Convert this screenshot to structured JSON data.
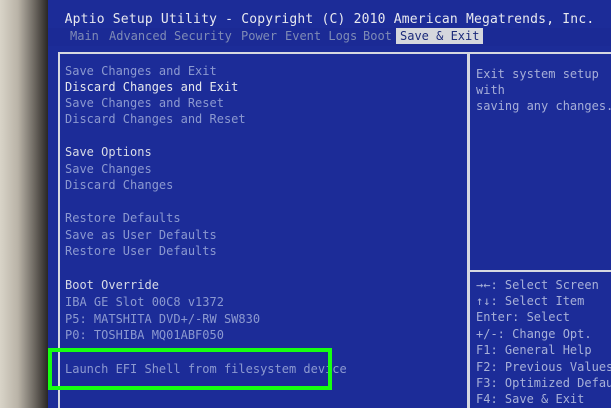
{
  "bios": {
    "title": "Aptio Setup Utility - Copyright (C) 2010 American Megatrends, Inc.",
    "menu": [
      "Main",
      "Advanced",
      "Security",
      "Power",
      "Event Logs",
      "Boot",
      "Save & Exit"
    ],
    "items": [
      "Save Changes and Exit",
      "Discard Changes and Exit",
      "Save Changes and Reset",
      "Discard Changes and Reset",
      "Save Options",
      "Save Changes",
      "Discard Changes",
      "Restore Defaults",
      "Save as User Defaults",
      "Restore User Defaults",
      "Boot Override",
      "IBA GE Slot 00C8 v1372",
      "P5: MATSHITA DVD+/-RW SW830",
      "P0: TOSHIBA MQ01ABF050",
      "Launch EFI Shell from filesystem device"
    ],
    "description_lines": [
      "Exit system setup with",
      "saving any changes."
    ],
    "help_lines": [
      "→←: Select Screen",
      "↑↓: Select Item",
      "Enter: Select",
      "+/-: Change Opt.",
      "F1: General Help",
      "F2: Previous Values",
      "F3: Optimized Defaults",
      "F4: Save & Exit"
    ],
    "colors": {
      "screen_background": "#1c2c98",
      "active_menu_background": "#d5d7dd",
      "annotation_highlight": "#17ff12"
    }
  }
}
